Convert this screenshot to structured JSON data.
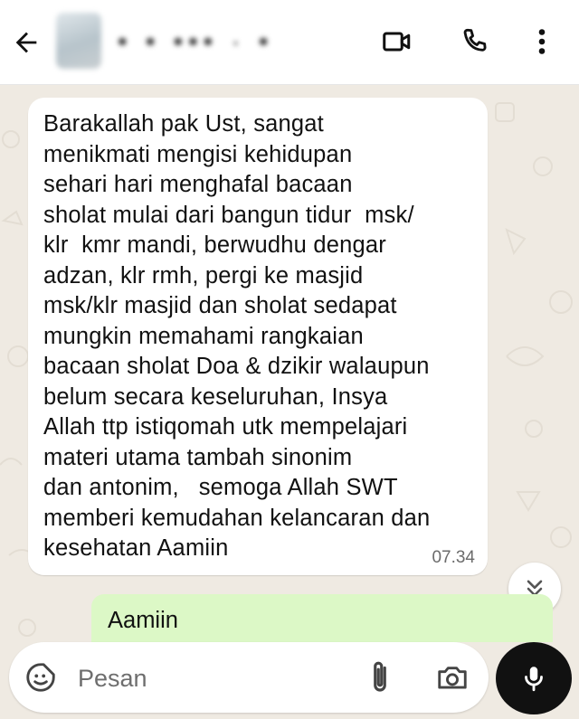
{
  "header": {
    "contact_name": "• • •••   · •",
    "icons": [
      "back-arrow-icon",
      "video-call-icon",
      "phone-call-icon",
      "more-options-icon"
    ]
  },
  "messages": [
    {
      "direction": "incoming",
      "text": "Barakallah pak Ust, sangat\nmenikmati mengisi kehidupan\nsehari hari menghafal bacaan\nsholat mulai dari bangun tidur  msk/\nklr  kmr mandi, berwudhu dengar\nadzan, klr rmh, pergi ke masjid\nmsk/klr masjid dan sholat sedapat\nmungkin memahami rangkaian\nbacaan sholat Doa & dzikir walaupun\nbelum secara keseluruhan, Insya\nAllah ttp istiqomah utk mempelajari\nmateri utama tambah sinonim\ndan antonim,   semoga Allah SWT\nmemberi kemudahan kelancaran dan\nkesehatan Aamiin",
      "time": "07.34"
    },
    {
      "direction": "outgoing",
      "text": "Aamiin"
    }
  ],
  "composer": {
    "placeholder": "Pesan",
    "value": "",
    "icons": [
      "emoji-icon",
      "attach-icon",
      "camera-icon",
      "mic-icon"
    ]
  },
  "colors": {
    "header_bg": "#ffffff",
    "chat_bg": "#efeae2",
    "incoming_bubble": "#ffffff",
    "outgoing_bubble": "#dcf8c6",
    "mic_button": "#111111"
  }
}
